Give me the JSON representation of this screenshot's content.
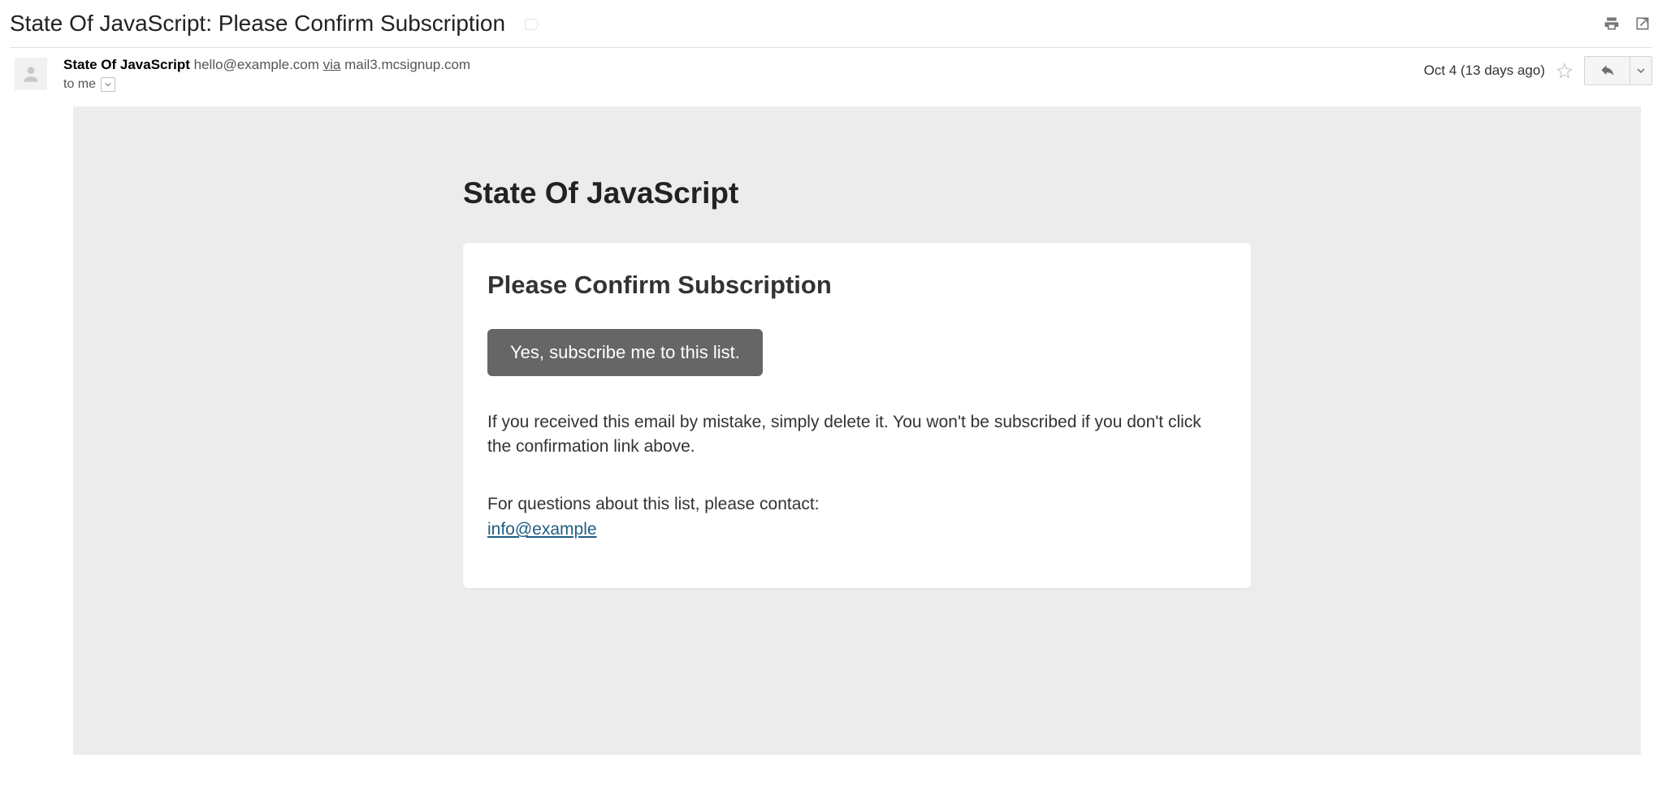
{
  "subject": "State Of JavaScript: Please Confirm Subscription",
  "sender": {
    "name": "State Of JavaScript",
    "address": "hello@example.com",
    "via_word": "via",
    "via_host": "mail3.mcsignup.com"
  },
  "recipient": {
    "label": "to me"
  },
  "date": "Oct 4 (13 days ago)",
  "body": {
    "brand": "State Of JavaScript",
    "card_title": "Please Confirm Subscription",
    "button": "Yes, subscribe me to this list.",
    "mistake_text": "If you received this email by mistake, simply delete it. You won't be subscribed if you don't click the confirmation link above.",
    "questions_text": "For questions about this list, please contact:",
    "contact_email": "info@example"
  }
}
